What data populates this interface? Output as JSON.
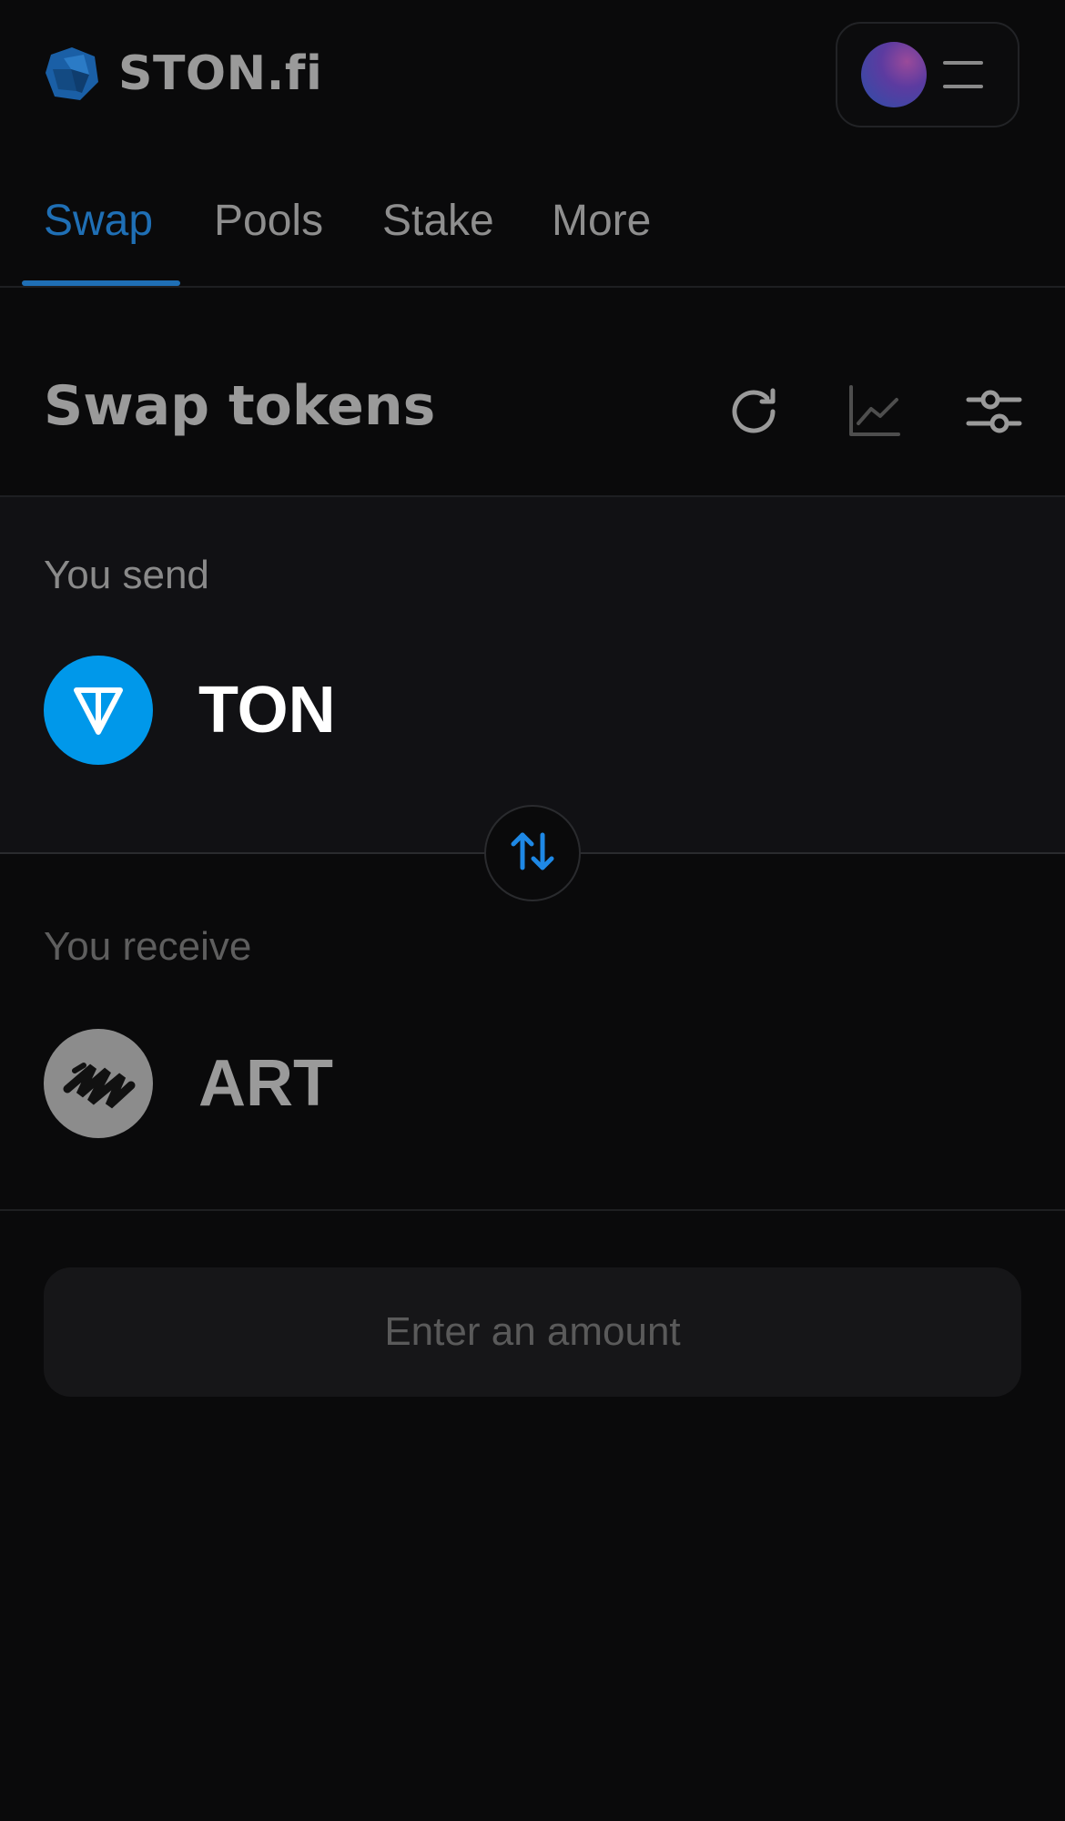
{
  "header": {
    "logo_text": "STON.fi",
    "logo_icon": "ston-logo-icon",
    "menu_icon": "hamburger-icon",
    "avatar_icon": "wallet-avatar"
  },
  "nav": {
    "tabs": [
      {
        "label": "Swap",
        "active": true
      },
      {
        "label": "Pools",
        "active": false
      },
      {
        "label": "Stake",
        "active": false
      },
      {
        "label": "More",
        "active": false
      }
    ]
  },
  "swap": {
    "title": "Swap tokens",
    "tools": [
      "refresh-icon",
      "chart-icon",
      "settings-sliders-icon"
    ],
    "send": {
      "label": "You send",
      "token_symbol": "TON",
      "token_icon": "ton-icon"
    },
    "switch_icon": "swap-arrows-icon",
    "receive": {
      "label": "You receive",
      "token_symbol": "ART",
      "token_icon": "art-icon"
    },
    "action_label": "Enter an amount"
  },
  "colors": {
    "background": "#0a0a0b",
    "accent": "#1f6fb5",
    "ton_blue": "#0098ea",
    "panel": "#111114",
    "muted_text": "#8e8e8e"
  }
}
